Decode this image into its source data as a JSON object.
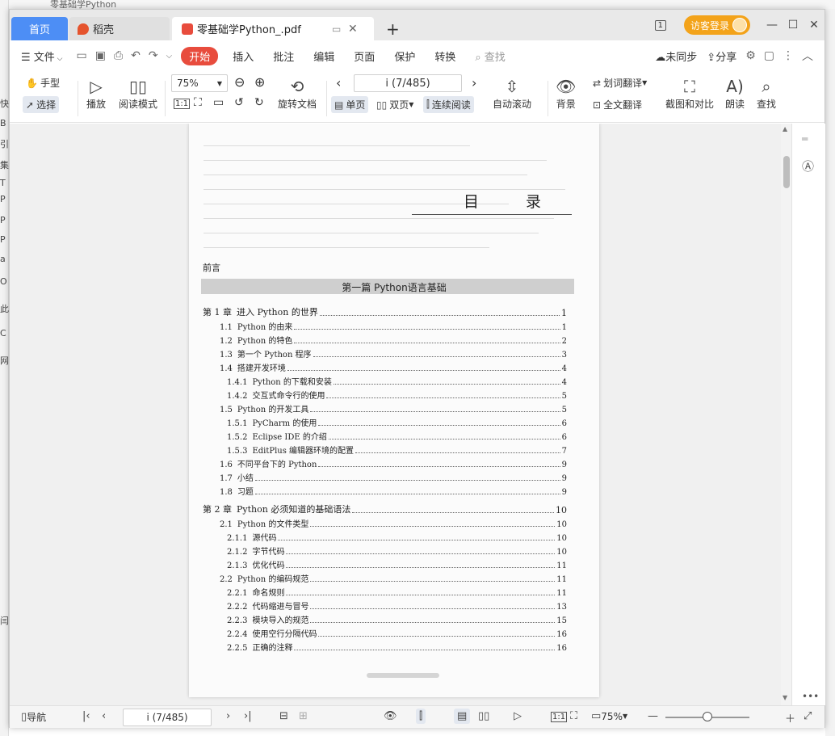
{
  "desktop_fragments": [
    "快",
    "B",
    "引",
    "集",
    "T",
    "P",
    "P",
    "P",
    "a",
    "O",
    "此",
    "C",
    "网",
    "闫"
  ],
  "desktop_top_text": "零基础学Python",
  "tabs": {
    "home": "首页",
    "daoke": "稻壳",
    "pdf": "零基础学Python_.pdf",
    "new_tab": "+"
  },
  "titlebar": {
    "visitor_login": "访客登录",
    "badge": "1"
  },
  "menu": {
    "file": "文件",
    "start": "开始",
    "insert": "插入",
    "annotate": "批注",
    "edit": "编辑",
    "page": "页面",
    "protect": "保护",
    "convert": "转换",
    "search_placeholder": "查找",
    "sync": "未同步",
    "share": "分享"
  },
  "ribbon": {
    "hand": "手型",
    "select": "选择",
    "play": "播放",
    "reading_mode": "阅读模式",
    "zoom": "75%",
    "rotate_doc": "旋转文档",
    "page_indicator": "i (7/485)",
    "single_page": "单页",
    "double_page": "双页",
    "continuous": "连续阅读",
    "auto_scroll": "自动滚动",
    "background": "背景",
    "word_translate": "划词翻译",
    "full_translate": "全文翻译",
    "screenshot_compare": "截图和对比",
    "read_aloud": "朗读",
    "find": "查找",
    "actual_size": "1:1"
  },
  "document": {
    "toc_title": "目 录",
    "preface": "前言",
    "part_title": "第一篇   Python语言基础",
    "toc": [
      {
        "num": "第 1 章",
        "text": "进入 Python 的世界",
        "page": "1",
        "level": 0
      },
      {
        "num": "1.1",
        "text": "Python 的由来",
        "page": "1",
        "level": 1
      },
      {
        "num": "1.2",
        "text": "Python 的特色",
        "page": "2",
        "level": 1
      },
      {
        "num": "1.3",
        "text": "第一个 Python 程序",
        "page": "3",
        "level": 1
      },
      {
        "num": "1.4",
        "text": "搭建开发环境",
        "page": "4",
        "level": 1
      },
      {
        "num": "1.4.1",
        "text": "Python 的下载和安装",
        "page": "4",
        "level": 2
      },
      {
        "num": "1.4.2",
        "text": "交互式命令行的使用",
        "page": "5",
        "level": 2
      },
      {
        "num": "1.5",
        "text": "Python 的开发工具",
        "page": "5",
        "level": 1
      },
      {
        "num": "1.5.1",
        "text": "PyCharm 的使用",
        "page": "6",
        "level": 2
      },
      {
        "num": "1.5.2",
        "text": "Eclipse IDE 的介绍",
        "page": "6",
        "level": 2
      },
      {
        "num": "1.5.3",
        "text": "EditPlus 编辑器环境的配置",
        "page": "7",
        "level": 2
      },
      {
        "num": "1.6",
        "text": "不同平台下的 Python",
        "page": "9",
        "level": 1
      },
      {
        "num": "1.7",
        "text": "小结",
        "page": "9",
        "level": 1
      },
      {
        "num": "1.8",
        "text": "习题",
        "page": "9",
        "level": 1
      },
      {
        "num": "第 2 章",
        "text": "Python 必须知道的基础语法",
        "page": "10",
        "level": 0
      },
      {
        "num": "2.1",
        "text": "Python 的文件类型",
        "page": "10",
        "level": 1
      },
      {
        "num": "2.1.1",
        "text": "源代码",
        "page": "10",
        "level": 2
      },
      {
        "num": "2.1.2",
        "text": "字节代码",
        "page": "10",
        "level": 2
      },
      {
        "num": "2.1.3",
        "text": "优化代码",
        "page": "11",
        "level": 2
      },
      {
        "num": "2.2",
        "text": "Python 的编码规范",
        "page": "11",
        "level": 1
      },
      {
        "num": "2.2.1",
        "text": "命名规则",
        "page": "11",
        "level": 2
      },
      {
        "num": "2.2.2",
        "text": "代码缩进与冒号",
        "page": "13",
        "level": 2
      },
      {
        "num": "2.2.3",
        "text": "模块导入的规范",
        "page": "15",
        "level": 2
      },
      {
        "num": "2.2.4",
        "text": "使用空行分隔代码",
        "page": "16",
        "level": 2
      },
      {
        "num": "2.2.5",
        "text": "正确的注释",
        "page": "16",
        "level": 2
      }
    ]
  },
  "statusbar": {
    "navigation": "导航",
    "page_indicator": "i (7/485)",
    "zoom": "75%",
    "actual_size": "1:1",
    "zoom_level_fraction": 0.5
  },
  "colors": {
    "home_tab": "#4d8ef5",
    "start_menu": "#e84c3d",
    "visitor_badge": "#f3a31a"
  }
}
